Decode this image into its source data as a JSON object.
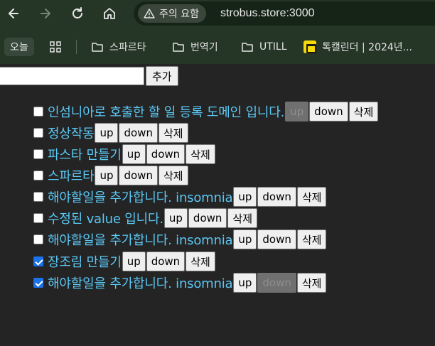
{
  "browser": {
    "security_chip": "주의 요함",
    "url": "strobus.store:3000"
  },
  "bookmarks": {
    "today": "오늘",
    "items": [
      {
        "label": "스파르타"
      },
      {
        "label": "번역기"
      },
      {
        "label": "UTILL"
      },
      {
        "label": "톡캘린더 | 2024년..."
      }
    ]
  },
  "form": {
    "input_value": "",
    "add_label": "추가"
  },
  "buttons": {
    "up": "up",
    "down": "down",
    "delete": "삭제"
  },
  "todos": [
    {
      "text": "인섬니아로 호출한 할 일 등록 도메인 입니다.",
      "checked": false,
      "up_disabled": true,
      "down_disabled": false
    },
    {
      "text": "정상작동",
      "checked": false,
      "up_disabled": false,
      "down_disabled": false
    },
    {
      "text": "파스타 만들기",
      "checked": false,
      "up_disabled": false,
      "down_disabled": false
    },
    {
      "text": "스파르타",
      "checked": false,
      "up_disabled": false,
      "down_disabled": false
    },
    {
      "text": "해야할일을 추가합니다. insomnia",
      "checked": false,
      "up_disabled": false,
      "down_disabled": false
    },
    {
      "text": "수정된 value 입니다.",
      "checked": false,
      "up_disabled": false,
      "down_disabled": false
    },
    {
      "text": "해야할일을 추가합니다. insomnia",
      "checked": false,
      "up_disabled": false,
      "down_disabled": false
    },
    {
      "text": "장조림 만들기",
      "checked": true,
      "up_disabled": false,
      "down_disabled": false
    },
    {
      "text": "해야할일을 추가합니다. insomnia",
      "checked": true,
      "up_disabled": false,
      "down_disabled": true
    }
  ],
  "colors": {
    "todo_text": "#5bc8f5",
    "background": "#242424",
    "browser_chrome": "#263626"
  }
}
